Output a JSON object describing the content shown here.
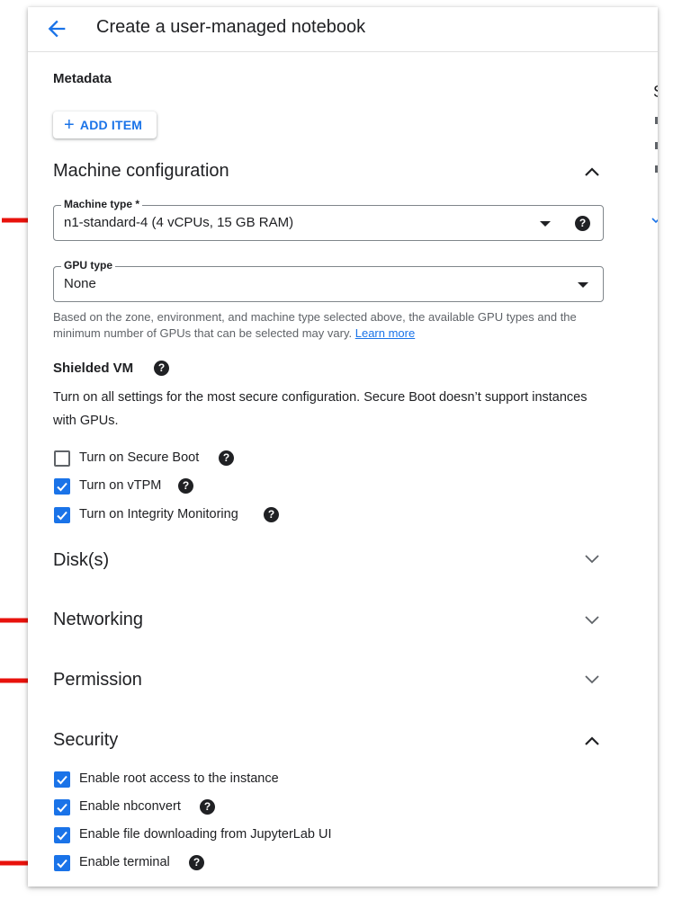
{
  "header": {
    "title": "Create a user-managed notebook",
    "back_icon": "arrow-back-icon"
  },
  "metadata": {
    "label": "Metadata",
    "add_item_label": "ADD ITEM"
  },
  "side": {
    "letter": "S"
  },
  "machine_config": {
    "heading": "Machine configuration",
    "machine_type_label": "Machine type *",
    "machine_type_value": "n1-standard-4 (4 vCPUs, 15 GB RAM)",
    "gpu_type_label": "GPU type",
    "gpu_type_value": "None",
    "gpu_hint": "Based on the zone, environment, and machine type selected above, the available GPU types and the minimum number of GPUs that can be selected may vary.",
    "learn_more": "Learn more"
  },
  "shielded_vm": {
    "heading": "Shielded VM",
    "description": "Turn on all settings for the most secure configuration. Secure Boot doesn’t support instances with GPUs.",
    "options": [
      {
        "label": "Turn on Secure Boot",
        "checked": false
      },
      {
        "label": "Turn on vTPM",
        "checked": true
      },
      {
        "label": "Turn on Integrity Monitoring",
        "checked": true
      }
    ]
  },
  "sections": {
    "disks": "Disk(s)",
    "networking": "Networking",
    "permission": "Permission",
    "security": "Security"
  },
  "security": {
    "options": [
      {
        "label": "Enable root access to the instance",
        "checked": true
      },
      {
        "label": "Enable nbconvert",
        "checked": true
      },
      {
        "label": "Enable file downloading from JupyterLab UI",
        "checked": true
      },
      {
        "label": "Enable terminal",
        "checked": true
      }
    ]
  },
  "colors": {
    "accent": "#1a73e8",
    "annotation_arrow": "#e8120c",
    "text": "#202124"
  }
}
